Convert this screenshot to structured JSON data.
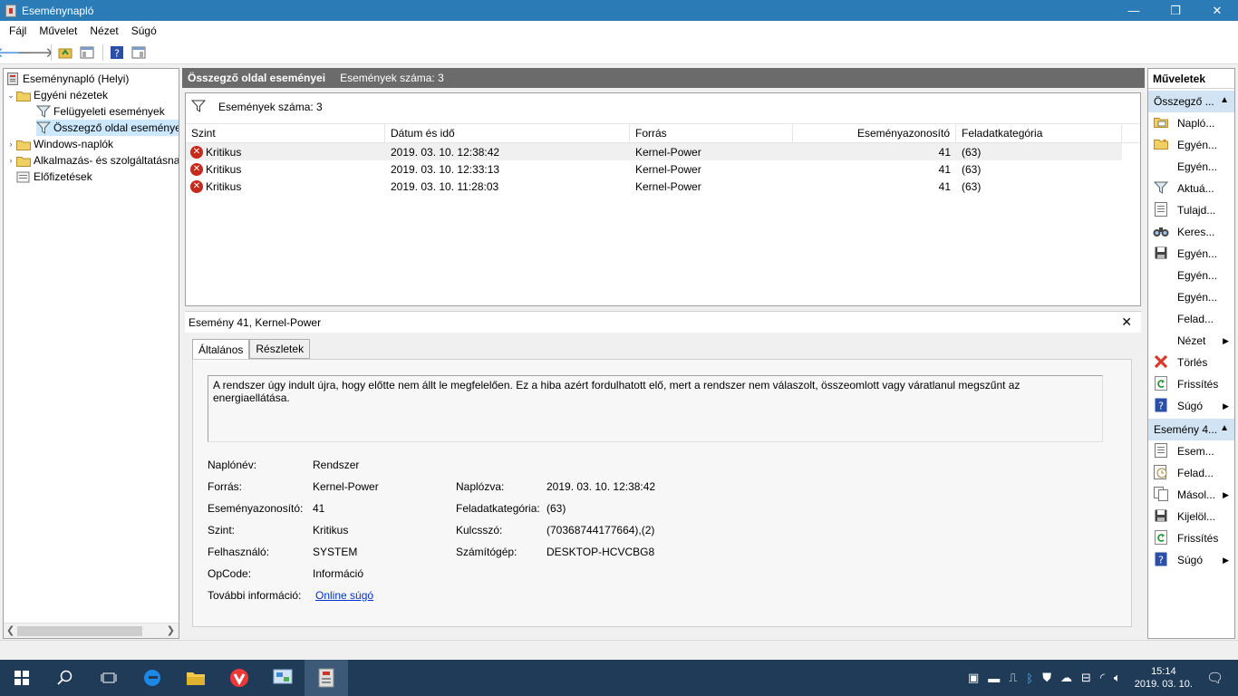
{
  "window": {
    "title": "Eseménynapló",
    "minimize": "—",
    "maximize": "❐",
    "close": "✕"
  },
  "menu": [
    "Fájl",
    "Művelet",
    "Nézet",
    "Súgó"
  ],
  "tree": {
    "root": "Eseménynapló (Helyi)",
    "custom_views": "Egyéni nézetek",
    "admin_events": "Felügyeleti események",
    "summary_events": "Összegző oldal eseményei",
    "windows_logs": "Windows-naplók",
    "app_logs": "Alkalmazás- és szolgáltatásnaplók",
    "subscriptions": "Előfizetések"
  },
  "center": {
    "header_title": "Összegző oldal eseményei",
    "header_count": "Események száma: 3",
    "filter_text": "Események száma: 3",
    "columns": [
      "Szint",
      "Dátum és idő",
      "Forrás",
      "Eseményazonosító",
      "Feladatkategória"
    ],
    "rows": [
      {
        "level": "Kritikus",
        "datetime": "2019. 03. 10. 12:38:42",
        "source": "Kernel-Power",
        "id": "41",
        "category": "(63)"
      },
      {
        "level": "Kritikus",
        "datetime": "2019. 03. 10. 12:33:13",
        "source": "Kernel-Power",
        "id": "41",
        "category": "(63)"
      },
      {
        "level": "Kritikus",
        "datetime": "2019. 03. 10. 11:28:03",
        "source": "Kernel-Power",
        "id": "41",
        "category": "(63)"
      }
    ]
  },
  "detail": {
    "title": "Esemény 41, Kernel-Power",
    "tabs": [
      "Általános",
      "Részletek"
    ],
    "message": "A rendszer úgy indult újra, hogy előtte nem állt le megfelelően. Ez a hiba azért fordulhatott elő, mert a rendszer nem válaszolt, összeomlott vagy váratlanul megszűnt az energiaellátása.",
    "labels": {
      "log_name": "Naplónév:",
      "source": "Forrás:",
      "event_id": "Eseményazonosító:",
      "level": "Szint:",
      "user": "Felhasználó:",
      "opcode": "OpCode:",
      "more_info": "További információ:",
      "logged": "Naplózva:",
      "task_category": "Feladatkategória:",
      "keywords": "Kulcsszó:",
      "computer": "Számítógép:"
    },
    "values": {
      "log_name": "Rendszer",
      "source": "Kernel-Power",
      "event_id": "41",
      "level": "Kritikus",
      "user": "SYSTEM",
      "opcode": "Információ",
      "more_info": "Online súgó",
      "logged": "2019. 03. 10. 12:38:42",
      "task_category": "(63)",
      "keywords": "(70368744177664),(2)",
      "computer": "DESKTOP-HCVCBG8"
    }
  },
  "actions": {
    "title": "Műveletek",
    "section1": "Összegző ...",
    "items1": [
      {
        "icon": "open-log-icon",
        "label": "Napló..."
      },
      {
        "icon": "folder-icon",
        "label": "Egyén..."
      },
      {
        "icon": "",
        "label": "Egyén..."
      },
      {
        "icon": "filter-icon",
        "label": "Aktuá..."
      },
      {
        "icon": "properties-icon",
        "label": "Tulajd..."
      },
      {
        "icon": "binoculars-icon",
        "label": "Keres..."
      },
      {
        "icon": "save-icon",
        "label": "Egyén..."
      },
      {
        "icon": "",
        "label": "Egyén..."
      },
      {
        "icon": "",
        "label": "Egyén..."
      },
      {
        "icon": "",
        "label": "Felad..."
      },
      {
        "icon": "",
        "label": "Nézet",
        "arrow": true
      },
      {
        "icon": "delete-icon",
        "label": "Törlés"
      },
      {
        "icon": "refresh-icon",
        "label": "Frissítés"
      },
      {
        "icon": "help-icon",
        "label": "Súgó",
        "arrow": true
      }
    ],
    "section2": "Esemény 4...",
    "items2": [
      {
        "icon": "event-properties-icon",
        "label": "Esem..."
      },
      {
        "icon": "task-icon",
        "label": "Felad..."
      },
      {
        "icon": "copy-icon",
        "label": "Másol...",
        "arrow": true
      },
      {
        "icon": "save-icon",
        "label": "Kijelöl..."
      },
      {
        "icon": "refresh-icon",
        "label": "Frissítés"
      },
      {
        "icon": "help-icon",
        "label": "Súgó",
        "arrow": true
      }
    ]
  },
  "taskbar": {
    "time": "15:14",
    "date": "2019. 03. 10."
  },
  "colors": {
    "titlebar": "#2b7bb6",
    "header": "#6b6b6b",
    "selection": "#cce8ff",
    "taskbar": "#1f3b57"
  }
}
